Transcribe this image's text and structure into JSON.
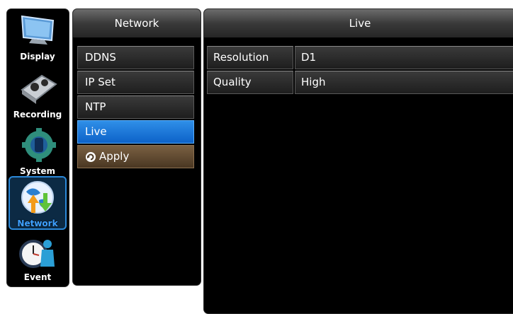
{
  "sidebar": {
    "categories": [
      {
        "label": "Display",
        "icon": "monitor-icon"
      },
      {
        "label": "Recording",
        "icon": "recording-icon"
      },
      {
        "label": "System",
        "icon": "system-gear-icon"
      },
      {
        "label": "Network",
        "icon": "network-globe-icon",
        "active": true
      },
      {
        "label": "Event",
        "icon": "event-clock-icon"
      }
    ]
  },
  "menu": {
    "title": "Network",
    "items": [
      {
        "label": "DDNS"
      },
      {
        "label": "IP Set"
      },
      {
        "label": "NTP"
      },
      {
        "label": "Live",
        "selected": true
      },
      {
        "label": "Apply",
        "icon": "refresh-icon"
      }
    ]
  },
  "content": {
    "title": "Live",
    "rows": [
      {
        "key": "Resolution",
        "value": "D1"
      },
      {
        "key": "Quality",
        "value": "High"
      }
    ]
  },
  "colors": {
    "accent": "#1d7ae0",
    "apply": "#6a5036",
    "active_border": "#2b88d8"
  }
}
